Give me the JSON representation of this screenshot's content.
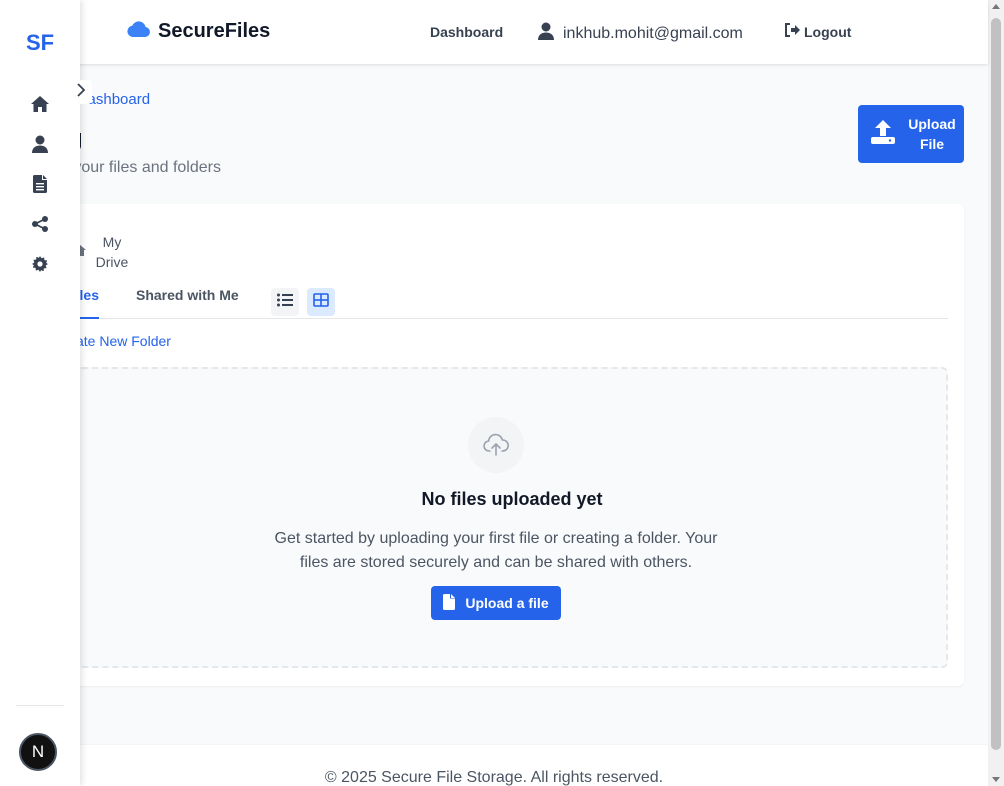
{
  "brand": {
    "name": "SecureFiles",
    "icon": "cloud-icon",
    "color": "#3b82f6"
  },
  "topnav": {
    "dashboard": "Dashboard",
    "user_email": "inkhub.mohit@gmail.com",
    "logout": "Logout"
  },
  "sidebar": {
    "logo": "SF",
    "items": [
      {
        "icon": "home-icon"
      },
      {
        "icon": "user-icon"
      },
      {
        "icon": "document-icon"
      },
      {
        "icon": "share-icon"
      },
      {
        "icon": "gear-icon"
      }
    ],
    "avatar_initial": "N"
  },
  "page": {
    "back_link": "to Dashboard",
    "title": "fg",
    "subtitle": "e your files and folders",
    "upload_button": "Upload File"
  },
  "folder_view": {
    "breadcrumb": "My Drive",
    "tabs": [
      {
        "label": "les",
        "active": true
      },
      {
        "label": "Shared with Me",
        "active": false
      }
    ],
    "view_mode": "grid",
    "new_folder": "ate New Folder"
  },
  "empty_state": {
    "title": "No files uploaded yet",
    "text": "Get started by uploading your first file or creating a folder. Your files are stored securely and can be shared with others.",
    "button": "Upload a file"
  },
  "footer": {
    "text": "© 2025 Secure File Storage. All rights reserved."
  },
  "colors": {
    "accent": "#2563eb",
    "background": "#f9fafb"
  }
}
